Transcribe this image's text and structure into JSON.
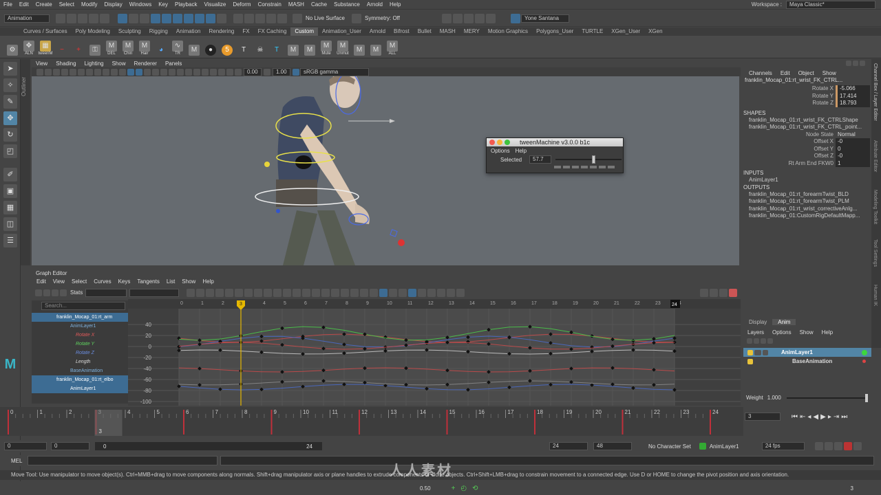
{
  "menubar": {
    "items": [
      "File",
      "Edit",
      "Create",
      "Select",
      "Modify",
      "Display",
      "Windows",
      "Key",
      "Playback",
      "Visualize",
      "Deform",
      "Constrain",
      "MASH",
      "Cache",
      "Substance",
      "Arnold",
      "Help"
    ],
    "workspace_label": "Workspace :",
    "workspace_value": "Maya Classic*"
  },
  "statusline": {
    "mode": "Animation",
    "live_surface": "No Live Surface",
    "symmetry": "Symmetry: Off",
    "user": "Yone Santana"
  },
  "shelf": {
    "tabs": [
      "Curves / Surfaces",
      "Poly Modeling",
      "Sculpting",
      "Rigging",
      "Animation",
      "Rendering",
      "FX",
      "FX Caching",
      "Custom",
      "Animation_User",
      "Arnold",
      "Bifrost",
      "Bullet",
      "MASH",
      "MERY",
      "Motion Graphics",
      "Polygons_User",
      "TURTLE",
      "XGen_User",
      "XGen"
    ],
    "active_tab": "Custom",
    "buttons": [
      "ALN",
      "tweenM",
      "",
      "",
      "",
      "DEL",
      "Chin",
      "Hair",
      "",
      "TR",
      "",
      "",
      "",
      "",
      "",
      "",
      "",
      "",
      "Mute",
      "Unmut",
      "",
      "",
      "ALL"
    ]
  },
  "outliner_label": "Outliner",
  "viewport": {
    "menu": [
      "View",
      "Shading",
      "Lighting",
      "Show",
      "Renderer",
      "Panels"
    ],
    "field_a": "0.00",
    "field_b": "1.00",
    "color_space": "sRGB gamma"
  },
  "tweenmachine": {
    "title": "tweenMachine v3.0.0 b1c",
    "menu": [
      "Options",
      "Help"
    ],
    "selected_label": "Selected",
    "selected_value": "57.7",
    "slider_fraction": 0.577
  },
  "channelbox": {
    "tabs": [
      "Channels",
      "Edit",
      "Object",
      "Show"
    ],
    "object": "franklin_Mocap_01:rt_wrist_FK_CTRL...",
    "attrs": [
      {
        "name": "Rotate X",
        "value": "-5.066"
      },
      {
        "name": "Rotate Y",
        "value": "17.414"
      },
      {
        "name": "Rotate Z",
        "value": "18.793"
      }
    ],
    "shapes_label": "SHAPES",
    "shapes": [
      "franklin_Mocap_01:rt_wrist_FK_CTRLShape",
      "franklin_Mocap_01:rt_wrist_FK_CTRL_point..."
    ],
    "shape_attrs": [
      {
        "name": "Node State",
        "value": "Normal"
      },
      {
        "name": "Offset X",
        "value": "-0"
      },
      {
        "name": "Offset Y",
        "value": "0"
      },
      {
        "name": "Offset Z",
        "value": "-0"
      },
      {
        "name": "Rt Arm End FKW0",
        "value": "1"
      }
    ],
    "inputs_label": "INPUTS",
    "inputs": [
      "AnimLayer1"
    ],
    "outputs_label": "OUTPUTS",
    "outputs": [
      "franklin_Mocap_01:rt_forearmTwist_BLD",
      "franklin_Mocap_01:rt_forearmTwist_PLM",
      "franklin_Mocap_01:rt_wrist_correctiveAnlg...",
      "franklin_Mocap_01:CustomRigDefaultMapp..."
    ]
  },
  "sidetabs": [
    "Channel Box / Layer Editor",
    "Attribute Editor",
    "Modeling Toolkit",
    "Tool Settings",
    "Human IK"
  ],
  "layers": {
    "tabs": [
      "Display",
      "Anim"
    ],
    "active_tab": "Anim",
    "menu": [
      "Layers",
      "Options",
      "Show",
      "Help"
    ],
    "items": [
      "AnimLayer1",
      "BaseAnimation"
    ],
    "weight_label": "Weight",
    "weight_value": "1.000"
  },
  "graph_editor": {
    "title": "Graph Editor",
    "menu": [
      "Edit",
      "View",
      "Select",
      "Curves",
      "Keys",
      "Tangents",
      "List",
      "Show",
      "Help"
    ],
    "stats_label": "Stats",
    "search_placeholder": "Search...",
    "outliner": [
      {
        "label": "franklin_Mocap_01:rt_arm",
        "kind": "node"
      },
      {
        "label": "AnimLayer1",
        "kind": "layer"
      },
      {
        "label": "Rotate X",
        "kind": "red"
      },
      {
        "label": "Rotate Y",
        "kind": "green"
      },
      {
        "label": "Rotate Z",
        "kind": "blue"
      },
      {
        "label": "Length",
        "kind": "plain"
      },
      {
        "label": "BaseAnimation",
        "kind": "layer"
      },
      {
        "label": "franklin_Mocap_01:rt_elbo",
        "kind": "node"
      },
      {
        "label": "AnimLayer1",
        "kind": "sel"
      }
    ],
    "y_ticks": [
      "40",
      "20",
      "0",
      "-20",
      "-40",
      "-60",
      "-80",
      "-100"
    ],
    "x_ticks": [
      "0",
      "1",
      "2",
      "3",
      "4",
      "5",
      "6",
      "7",
      "8",
      "9",
      "10",
      "11",
      "12",
      "13",
      "14",
      "15",
      "16",
      "17",
      "18",
      "19",
      "20",
      "21",
      "22",
      "23",
      "24"
    ],
    "current_frame": "3",
    "end_frame": "24"
  },
  "timeline": {
    "ticks": [
      "0",
      "1",
      "2",
      "3",
      "4",
      "5",
      "6",
      "7",
      "8",
      "9",
      "10",
      "11",
      "12",
      "13",
      "14",
      "15",
      "16",
      "17",
      "18",
      "19",
      "20",
      "21",
      "22",
      "23",
      "24"
    ],
    "current": "3",
    "current_field": "3"
  },
  "range": {
    "start": "0",
    "anim_start": "0",
    "range_start": "0",
    "range_end": "24",
    "end": "24",
    "anim_end": "48",
    "char_set": "No Character Set",
    "anim_layer": "AnimLayer1",
    "fps": "24 fps"
  },
  "cmdline": {
    "label": "MEL"
  },
  "helpline": {
    "text": "Move Tool: Use manipulator to move object(s). Ctrl+MMB+drag to move components along normals. Shift+drag manipulator axis or plane handles to extrude components or clone objects. Ctrl+Shift+LMB+drag to constrain movement to a connected edge. Use D or HOME to change the pivot position and axis orientation."
  },
  "bottom": {
    "value": "0.50",
    "frame": "3"
  },
  "watermark": "人人素材",
  "colors": {
    "accent": "#5285a6",
    "current_frame": "#e6b800",
    "selected": "#3d6c93"
  }
}
